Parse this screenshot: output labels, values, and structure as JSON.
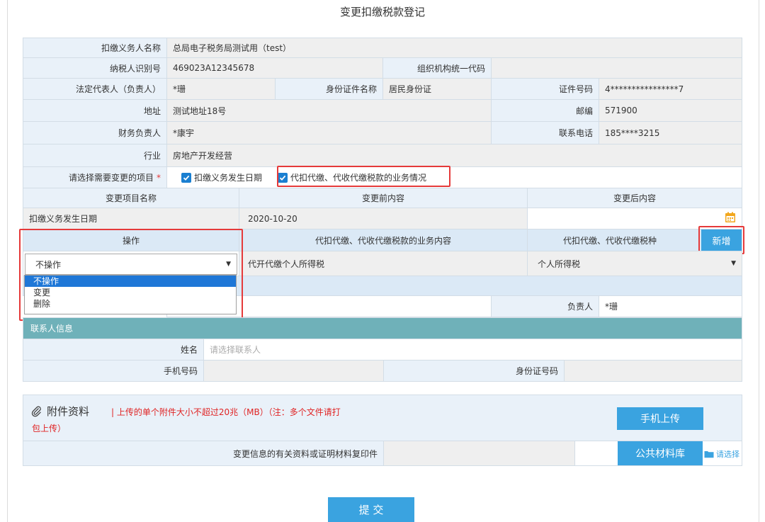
{
  "page_title": "变更扣缴税款登记",
  "withholder": {
    "label": "扣缴义务人名称",
    "value": "总局电子税务局测试用（test）"
  },
  "taxpayer_id": {
    "label": "纳税人识别号",
    "value": "469023A12345678"
  },
  "org_code": {
    "label": "组织机构统一代码",
    "value": ""
  },
  "legal_rep": {
    "label": "法定代表人（负责人）",
    "value": "*珊"
  },
  "id_type": {
    "label": "身份证件名称",
    "value": "居民身份证"
  },
  "id_number": {
    "label": "证件号码",
    "value": "4****************7"
  },
  "address": {
    "label": "地址",
    "value": "测试地址18号"
  },
  "postcode": {
    "label": "邮编",
    "value": "571900"
  },
  "finance_head": {
    "label": "财务负责人",
    "value": "*康宇"
  },
  "phone": {
    "label": "联系电话",
    "value": "185****3215"
  },
  "industry": {
    "label": "行业",
    "value": "房地产开发经营"
  },
  "change_select": {
    "label": "请选择需要变更的项目",
    "required_mark": "*",
    "options": [
      "扣缴义务发生日期",
      "代扣代缴、代收代缴税款的业务情况"
    ]
  },
  "change_table": {
    "headers": [
      "变更项目名称",
      "变更前内容",
      "变更后内容"
    ],
    "row": {
      "name": "扣缴义务发生日期",
      "before": "2020-10-20",
      "after": ""
    }
  },
  "business_table": {
    "headers": [
      "操作",
      "代扣代缴、代收代缴税款的业务内容",
      "代扣代缴、代收代缴税种"
    ],
    "add_button": "新增",
    "operation_value": "不操作",
    "operation_options": [
      "不操作",
      "变更",
      "删除"
    ],
    "content_value": "代开代缴个人所得税",
    "tax_type_value": "个人所得税"
  },
  "responsible": {
    "label": "负责人",
    "value": "*珊"
  },
  "contact_section": {
    "title": "联系人信息"
  },
  "contact_name": {
    "label": "姓名",
    "placeholder": "请选择联系人"
  },
  "contact_mobile": {
    "label": "手机号码",
    "value": ""
  },
  "contact_id": {
    "label": "身份证号码",
    "value": ""
  },
  "attachments": {
    "title": "附件资料",
    "note_line1": "| 上传的单个附件大小不超过20兆（MB）（注：多个文件请打",
    "note_line2": "包上传）",
    "mobile_upload": "手机上传",
    "file_label": "变更信息的有关资料或证明材料复印件",
    "public_library": "公共材料库",
    "choose": "请选择"
  },
  "submit": "提 交",
  "colors": {
    "accent": "#3aa3e0",
    "checkbox": "#1a7fd1",
    "highlight": "#e53a3a",
    "teal": "#6fb1b9"
  }
}
